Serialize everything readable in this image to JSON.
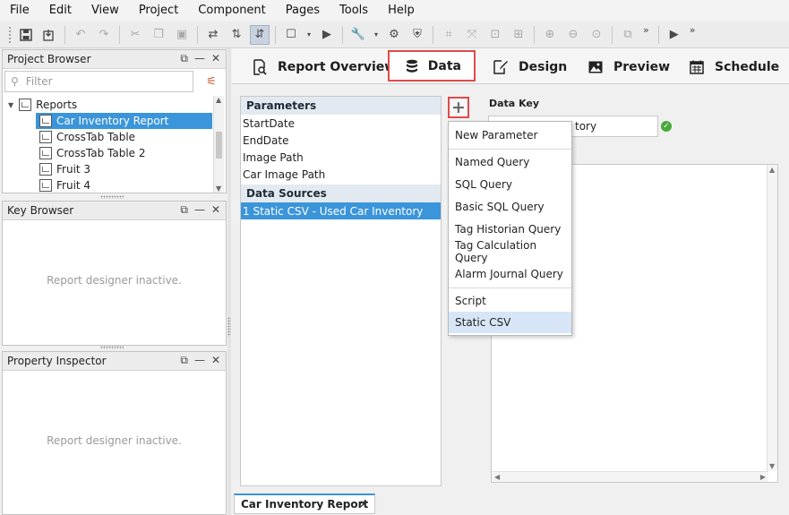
{
  "menubar": [
    "File",
    "Edit",
    "View",
    "Project",
    "Component",
    "Pages",
    "Tools",
    "Help"
  ],
  "project_browser": {
    "title": "Project Browser",
    "search_placeholder": "Filter",
    "tree": {
      "root": "Reports",
      "items": [
        "Car Inventory Report",
        "CrossTab Table",
        "CrossTab Table 2",
        "Fruit 3",
        "Fruit 4"
      ],
      "selected": "Car Inventory Report"
    }
  },
  "key_browser": {
    "title": "Key Browser",
    "status": "Report designer inactive."
  },
  "property_inspector": {
    "title": "Property Inspector",
    "status": "Report designer inactive."
  },
  "tabs": [
    {
      "label": "Report Overview",
      "icon": "magnify-doc-icon"
    },
    {
      "label": "Data",
      "icon": "database-icon",
      "active": true
    },
    {
      "label": "Design",
      "icon": "pencil-doc-icon"
    },
    {
      "label": "Preview",
      "icon": "image-icon"
    },
    {
      "label": "Schedule",
      "icon": "calendar-icon"
    }
  ],
  "parameters": {
    "header": "Parameters",
    "items": [
      "StartDate",
      "EndDate",
      "Image Path",
      "Car Image Path"
    ]
  },
  "data_sources": {
    "header": "Data Sources",
    "items": [
      "1 Static CSV - Used Car Inventory"
    ],
    "selected": "1 Static CSV - Used Car Inventory"
  },
  "data_key": {
    "label": "Data Key",
    "value": "tory"
  },
  "add_menu": {
    "group1": [
      "New Parameter"
    ],
    "group2": [
      "Named Query",
      "SQL Query",
      "Basic SQL Query",
      "Tag Historian Query",
      "Tag Calculation Query",
      "Alarm Journal Query"
    ],
    "group3": [
      "Script",
      "Static CSV"
    ],
    "highlighted": "Static CSV"
  },
  "document_tab": {
    "label": "Car Inventory Report"
  },
  "colors": {
    "accent": "#3b95da",
    "highlight_border": "#e04a4a",
    "valid": "#4aa83a"
  }
}
